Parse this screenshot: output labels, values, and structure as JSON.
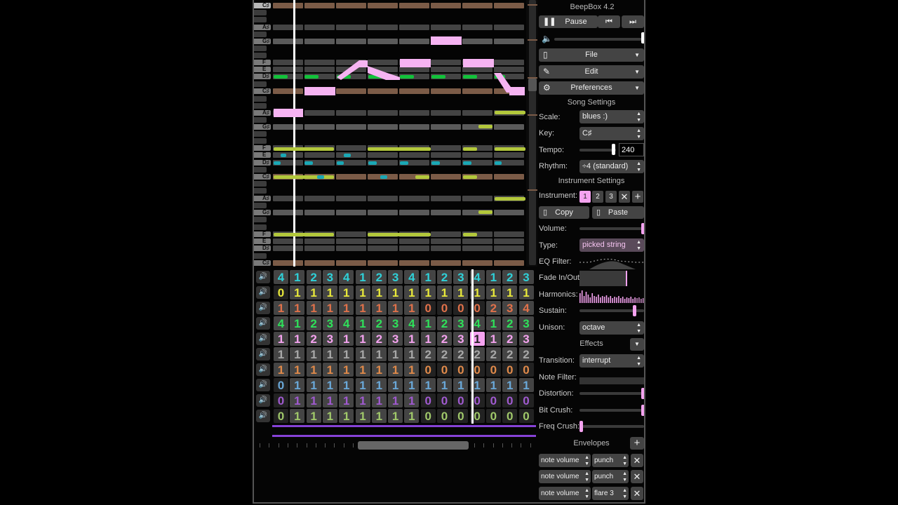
{
  "app": {
    "title": "BeepBox 4.2"
  },
  "transport": {
    "play_label": "Pause",
    "play_icon": "pause-icon",
    "prev_icon": "skip-back-icon",
    "next_icon": "skip-forward-icon"
  },
  "menus": {
    "file": "File",
    "edit": "Edit",
    "preferences": "Preferences"
  },
  "song_settings": {
    "heading": "Song Settings",
    "scale_label": "Scale:",
    "scale_value": "blues :)",
    "key_label": "Key:",
    "key_value": "C♯",
    "tempo_label": "Tempo:",
    "tempo_value": "240",
    "rhythm_label": "Rhythm:",
    "rhythm_value": "÷4 (standard)"
  },
  "instrument_settings": {
    "heading": "Instrument Settings",
    "instrument_label": "Instrument:",
    "instruments": [
      "1",
      "2",
      "3"
    ],
    "copy_label": "Copy",
    "paste_label": "Paste",
    "volume_label": "Volume:",
    "type_label": "Type:",
    "type_value": "picked string",
    "eq_label": "EQ Filter:",
    "fade_label": "Fade In/Out:",
    "harmonics_label": "Harmonics:",
    "sustain_label": "Sustain:",
    "unison_label": "Unison:",
    "unison_value": "octave",
    "effects_label": "Effects",
    "transition_label": "Transition:",
    "transition_value": "interrupt",
    "note_filter_label": "Note Filter:",
    "distortion_label": "Distortion:",
    "bitcrush_label": "Bit Crush:",
    "freqcrush_label": "Freq Crush:",
    "envelopes_label": "Envelopes",
    "envelopes": [
      {
        "target": "note volume",
        "type": "punch"
      },
      {
        "target": "note volume",
        "type": "punch"
      },
      {
        "target": "note volume",
        "type": "flare 3"
      }
    ]
  },
  "piano_labels": [
    "C♯",
    "A♯",
    "G♯",
    "F",
    "E",
    "D♯",
    "C♯",
    "A♯",
    "G♯",
    "F",
    "E",
    "D♯",
    "C♯",
    "A♯",
    "G♯",
    "F",
    "E",
    "D♯",
    "C♯"
  ],
  "pattern_grid": {
    "rows": [
      {
        "color": "#2fd0d8",
        "values": [
          "4",
          "1",
          "2",
          "3",
          "4",
          "1",
          "2",
          "3",
          "4",
          "1",
          "2",
          "3",
          "4",
          "1",
          "2",
          "3"
        ]
      },
      {
        "color": "#e8e83a",
        "values": [
          "0",
          "1",
          "1",
          "1",
          "1",
          "1",
          "1",
          "1",
          "1",
          "1",
          "1",
          "1",
          "1",
          "1",
          "1",
          "1"
        ]
      },
      {
        "color": "#e0714a",
        "values": [
          "1",
          "1",
          "1",
          "1",
          "1",
          "1",
          "1",
          "1",
          "1",
          "0",
          "0",
          "0",
          "0",
          "2",
          "3",
          "4"
        ]
      },
      {
        "color": "#2fe05a",
        "values": [
          "4",
          "1",
          "2",
          "3",
          "4",
          "1",
          "2",
          "3",
          "4",
          "1",
          "2",
          "3",
          "4",
          "1",
          "2",
          "3"
        ]
      },
      {
        "color": "#f5a3f0",
        "values": [
          "1",
          "1",
          "2",
          "3",
          "1",
          "1",
          "2",
          "3",
          "1",
          "1",
          "2",
          "3",
          "1",
          "1",
          "2",
          "3"
        ]
      },
      {
        "color": "#a8a8a8",
        "values": [
          "1",
          "1",
          "1",
          "1",
          "1",
          "1",
          "1",
          "1",
          "1",
          "2",
          "2",
          "2",
          "2",
          "2",
          "2",
          "2"
        ]
      },
      {
        "color": "#e08a4a",
        "values": [
          "1",
          "1",
          "1",
          "1",
          "1",
          "1",
          "1",
          "1",
          "1",
          "0",
          "0",
          "0",
          "0",
          "0",
          "0",
          "0"
        ]
      },
      {
        "color": "#6aa8d8",
        "values": [
          "0",
          "1",
          "1",
          "1",
          "1",
          "1",
          "1",
          "1",
          "1",
          "1",
          "1",
          "1",
          "1",
          "1",
          "1",
          "1"
        ]
      },
      {
        "color": "#a05ad0",
        "values": [
          "0",
          "1",
          "1",
          "1",
          "1",
          "1",
          "1",
          "1",
          "1",
          "0",
          "0",
          "0",
          "0",
          "0",
          "0",
          "0"
        ]
      },
      {
        "color": "#a0c86a",
        "values": [
          "0",
          "1",
          "1",
          "1",
          "1",
          "1",
          "1",
          "1",
          "1",
          "0",
          "0",
          "0",
          "0",
          "0",
          "0",
          "0"
        ]
      }
    ],
    "selected": {
      "row": 4,
      "col": 12
    }
  }
}
